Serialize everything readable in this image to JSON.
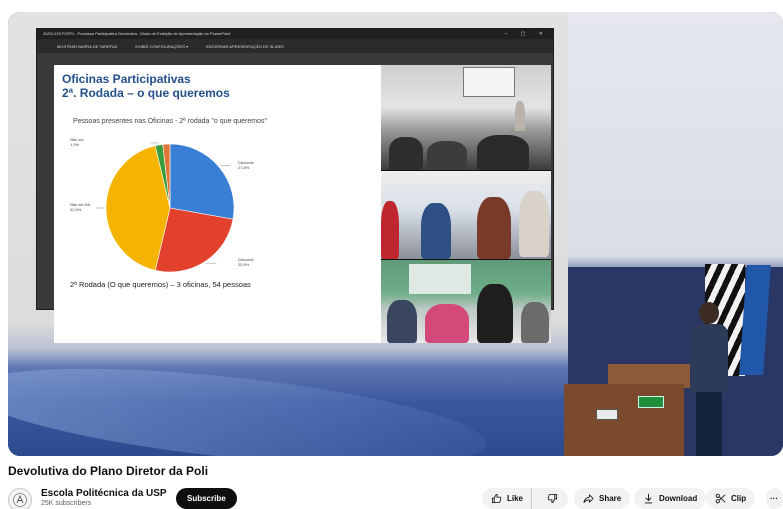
{
  "window": {
    "title": "20/01/125 FOPSI - Processo Participativo Devolutiva - Modo de Exibição de Apresentação do PowerPoint",
    "controls": "– ▢ ✕",
    "toolbar": [
      "MOSTRAR BARRA DE TAREFAS",
      "EXIBIR CONFIGURAÇÕES ▾",
      "ENCERRAR APRESENTAÇÃO DE SLIDES"
    ]
  },
  "slide": {
    "title_line1": "Oficinas Participativas",
    "title_line2": "2ª. Rodada – o que queremos",
    "footer": "2ª Rodada (O que queremos) – 3 oficinas, 54 pessoas"
  },
  "chart_data": {
    "type": "pie",
    "title": "Pessoas presentes nas Oficinas - 2ª rodada \"o que queremos\"",
    "slices": [
      {
        "label": "Discordo",
        "value": 27.8,
        "display": "27,8%",
        "color": "#3a7fd6"
      },
      {
        "label": "Discordo",
        "value": 25.9,
        "display": "25,9%",
        "color": "#e2422d"
      },
      {
        "label": "Não sei NA",
        "value": 42.6,
        "display": "42,6%",
        "color": "#f4b400"
      },
      {
        "label": "Não sei",
        "value": 1.9,
        "display": "1,9%",
        "color": "#3a9c3a"
      },
      {
        "label": "",
        "value": 1.8,
        "display": "",
        "color": "#e0753a"
      }
    ]
  },
  "video": {
    "title": "Devolutiva do Plano Diretor da Poli"
  },
  "channel": {
    "name": "Escola Politécnica da USP",
    "subscribers": "25K subscribers",
    "subscribe_label": "Subscribe"
  },
  "actions": {
    "like_label": "Like",
    "share_label": "Share",
    "download_label": "Download",
    "clip_label": "Clip",
    "more_label": "···"
  },
  "icons": [
    "like-icon",
    "dislike-icon",
    "share-icon",
    "download-icon",
    "clip-icon",
    "more-icon",
    "channel-avatar-icon"
  ]
}
